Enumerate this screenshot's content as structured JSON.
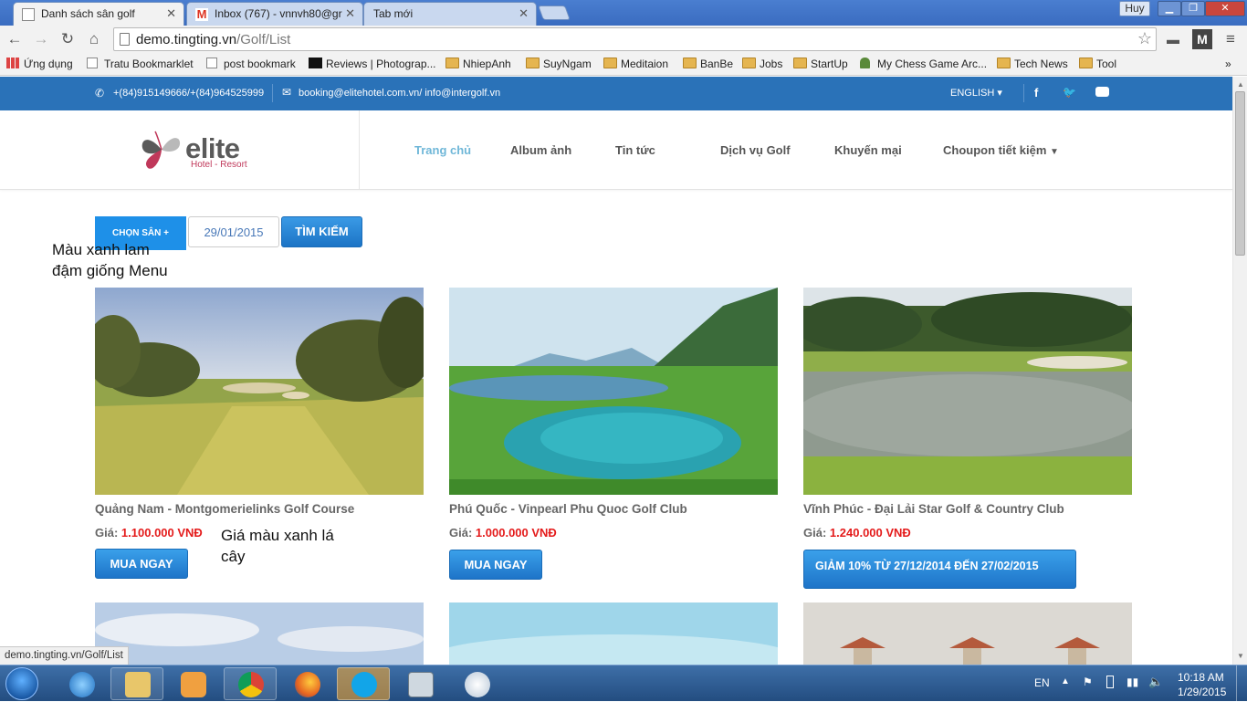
{
  "browser": {
    "tabs": [
      {
        "title": "Danh sách sân golf",
        "active": true
      },
      {
        "title": "Inbox (767) - vnnvh80@gr",
        "active": false
      },
      {
        "title": "Tab mới",
        "active": false
      }
    ],
    "user": "Huy",
    "url_host": "demo.tingting.vn",
    "url_path": "/Golf/List",
    "bookmarks": [
      {
        "label": "Ứng dụng",
        "icon": "apps-grid-icon"
      },
      {
        "label": "Tratu Bookmarklet",
        "icon": "page-icon"
      },
      {
        "label": "post bookmark",
        "icon": "page-icon"
      },
      {
        "label": "Reviews | Photograp...",
        "icon": "reviews-icon"
      },
      {
        "label": "NhiepAnh",
        "icon": "folder-icon"
      },
      {
        "label": "SuyNgam",
        "icon": "folder-icon"
      },
      {
        "label": "Meditaion",
        "icon": "folder-icon"
      },
      {
        "label": "BanBe",
        "icon": "folder-icon"
      },
      {
        "label": "Jobs",
        "icon": "folder-icon"
      },
      {
        "label": "StartUp",
        "icon": "folder-icon"
      },
      {
        "label": "My Chess Game Arc...",
        "icon": "chess-icon"
      },
      {
        "label": "Tech News",
        "icon": "folder-icon"
      },
      {
        "label": "Tool",
        "icon": "folder-icon"
      }
    ],
    "more_bookmarks": "»",
    "status_url": "demo.tingting.vn/Golf/List"
  },
  "site": {
    "phone": "+(84)915149666/+(84)964525999",
    "email": "booking@elitehotel.com.vn/ info@intergolf.vn",
    "language": "ENGLISH",
    "logo_word": "elite",
    "logo_sub": "Hotel - Resort",
    "menu": [
      "Trang chủ",
      "Album ảnh",
      "Tin tức",
      "Dịch vụ Golf",
      "Khuyến mại",
      "Choupon tiết kiệm"
    ],
    "colors": {
      "topbar": "#2a72b8",
      "button": "#1e74c8",
      "price": "#e41b1b",
      "menu_active": "#6fb7d8"
    }
  },
  "search": {
    "chon_san": "CHỌN SÂN +",
    "date": "29/01/2015",
    "button": "TÌM KIẾM"
  },
  "notes": {
    "note1_line1": "Màu xanh lam",
    "note1_line2": "đậm giống Menu",
    "note2_line1": "Giá màu xanh lá",
    "note2_line2": "cây"
  },
  "courses": [
    {
      "title": "Quảng Nam - Montgomerielinks Golf Course",
      "price_label": "Giá:",
      "price": "1.100.000 VNĐ",
      "button": "MUA NGAY"
    },
    {
      "title": "Phú Quốc - Vinpearl Phu Quoc Golf Club",
      "price_label": "Giá:",
      "price": "1.000.000 VNĐ",
      "button": "MUA NGAY"
    },
    {
      "title": "Vĩnh Phúc - Đại Lải Star Golf & Country Club",
      "price_label": "Giá:",
      "price": "1.240.000 VNĐ",
      "button": "GIẢM 10% TỪ 27/12/2014 ĐẾN 27/02/2015"
    }
  ],
  "taskbar": {
    "language": "EN",
    "time": "10:18 AM",
    "date": "1/29/2015",
    "apps": [
      "internet-explorer-icon",
      "file-explorer-icon",
      "media-player-icon",
      "chrome-icon",
      "firefox-icon",
      "skype-icon",
      "calculator-icon",
      "paint-icon"
    ]
  }
}
